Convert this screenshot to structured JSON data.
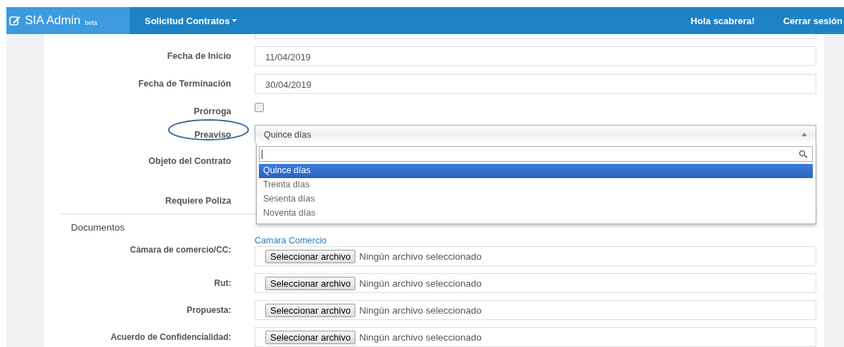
{
  "navbar": {
    "brand": "SIA Admin",
    "badge": "beta",
    "menu": "Solicitud Contratos",
    "greeting": "Hola scabrera!",
    "logout": "Cerrar sesión"
  },
  "fields": [
    {
      "kind": "date",
      "label": "Fecha de Inicio",
      "value": "11/04/2019"
    },
    {
      "kind": "date",
      "label": "Fecha de Terminación",
      "value": "30/04/2019"
    },
    {
      "kind": "checkbox",
      "label": "Prórroga",
      "checked": false
    },
    {
      "kind": "select",
      "label": "Preaviso",
      "value": "Quince días",
      "circled": true,
      "expanded": true,
      "options": [
        {
          "label": "Quince días",
          "selected": true
        },
        {
          "label": "Treinta días",
          "selected": false
        },
        {
          "label": "Sesenta días",
          "selected": false
        },
        {
          "label": "Noventa días",
          "selected": false
        }
      ]
    },
    {
      "kind": "tallblank",
      "label": "Objeto del Contrato"
    },
    {
      "kind": "blank",
      "label": "Requiere Poliza"
    }
  ],
  "documents": {
    "title": "Documentos",
    "items": [
      {
        "label": "Cámara de comercio/CC:",
        "link": "Camara Comercio",
        "button": "Seleccionar archivo",
        "status": "Ningún archivo seleccionado"
      },
      {
        "label": "Rut:",
        "button": "Seleccionar archivo",
        "status": "Ningún archivo seleccionado"
      },
      {
        "label": "Propuesta:",
        "button": "Seleccionar archivo",
        "status": "Ningún archivo seleccionado"
      },
      {
        "label": "Acuerdo de Confidencialidad:",
        "button": "Seleccionar archivo",
        "status": "Ningún archivo seleccionado"
      }
    ]
  }
}
